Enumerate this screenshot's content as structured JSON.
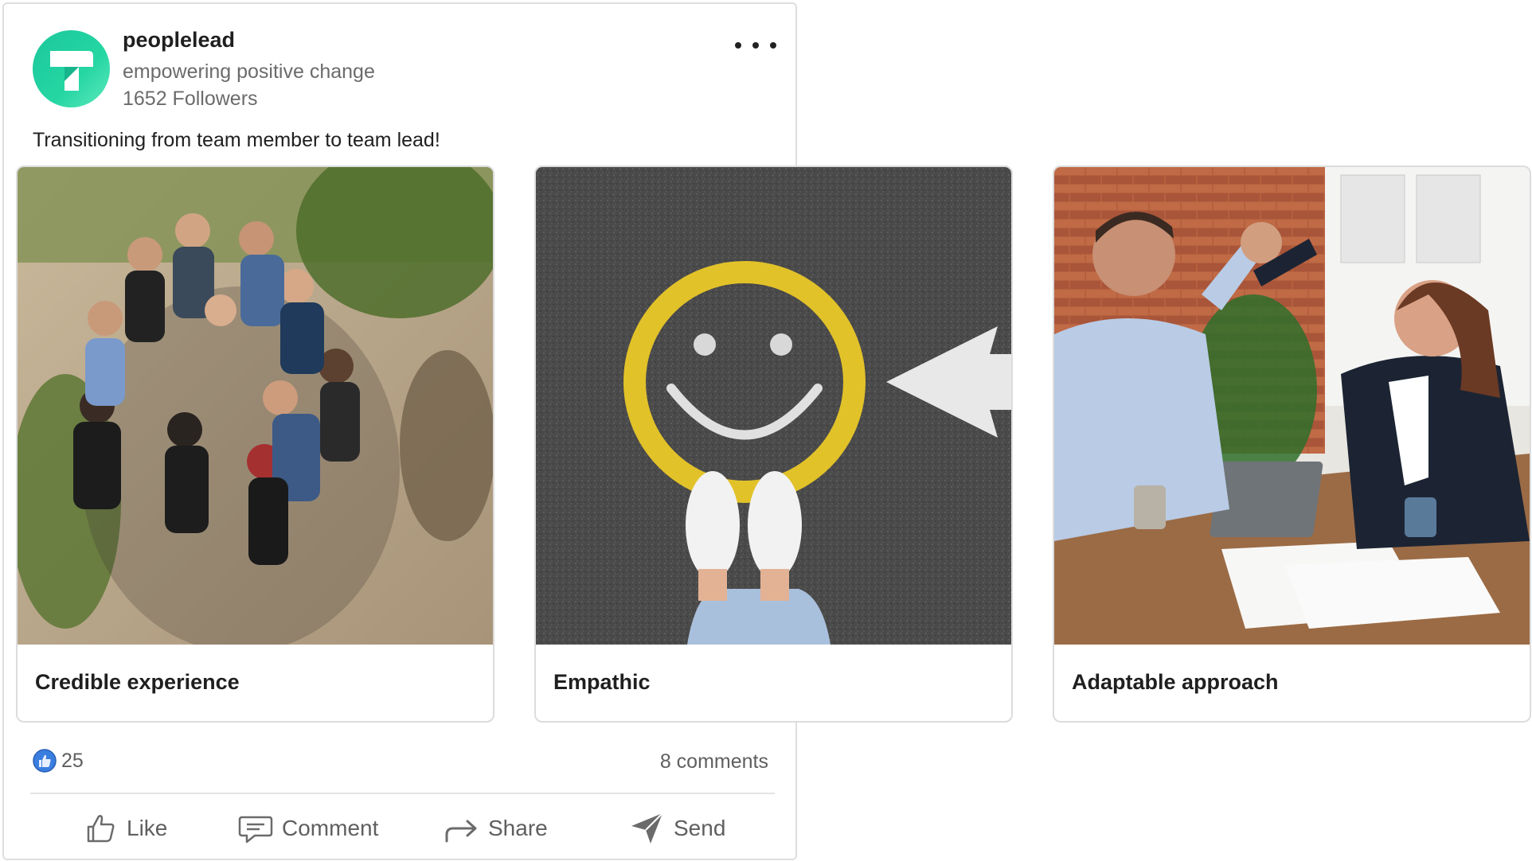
{
  "company": {
    "name": "peoplelead",
    "tagline": "empowering positive change",
    "followers": "1652 Followers",
    "logo_icon": "peoplelead-logo",
    "brand_color": "#22d3a0"
  },
  "post": {
    "text": "Transitioning from team member to team lead!",
    "more_icon": "more-horizontal-icon"
  },
  "carousel": [
    {
      "caption": "Credible experience",
      "image": "team-hands-together-photo"
    },
    {
      "caption": "Empathic",
      "image": "smiley-face-on-asphalt-photo"
    },
    {
      "caption": "Adaptable approach",
      "image": "office-high-five-photo"
    }
  ],
  "stats": {
    "reactions": "25",
    "reaction_icon": "like-reaction-icon",
    "comments": "8 comments"
  },
  "actions": {
    "like": "Like",
    "comment": "Comment",
    "share": "Share",
    "send": "Send"
  }
}
